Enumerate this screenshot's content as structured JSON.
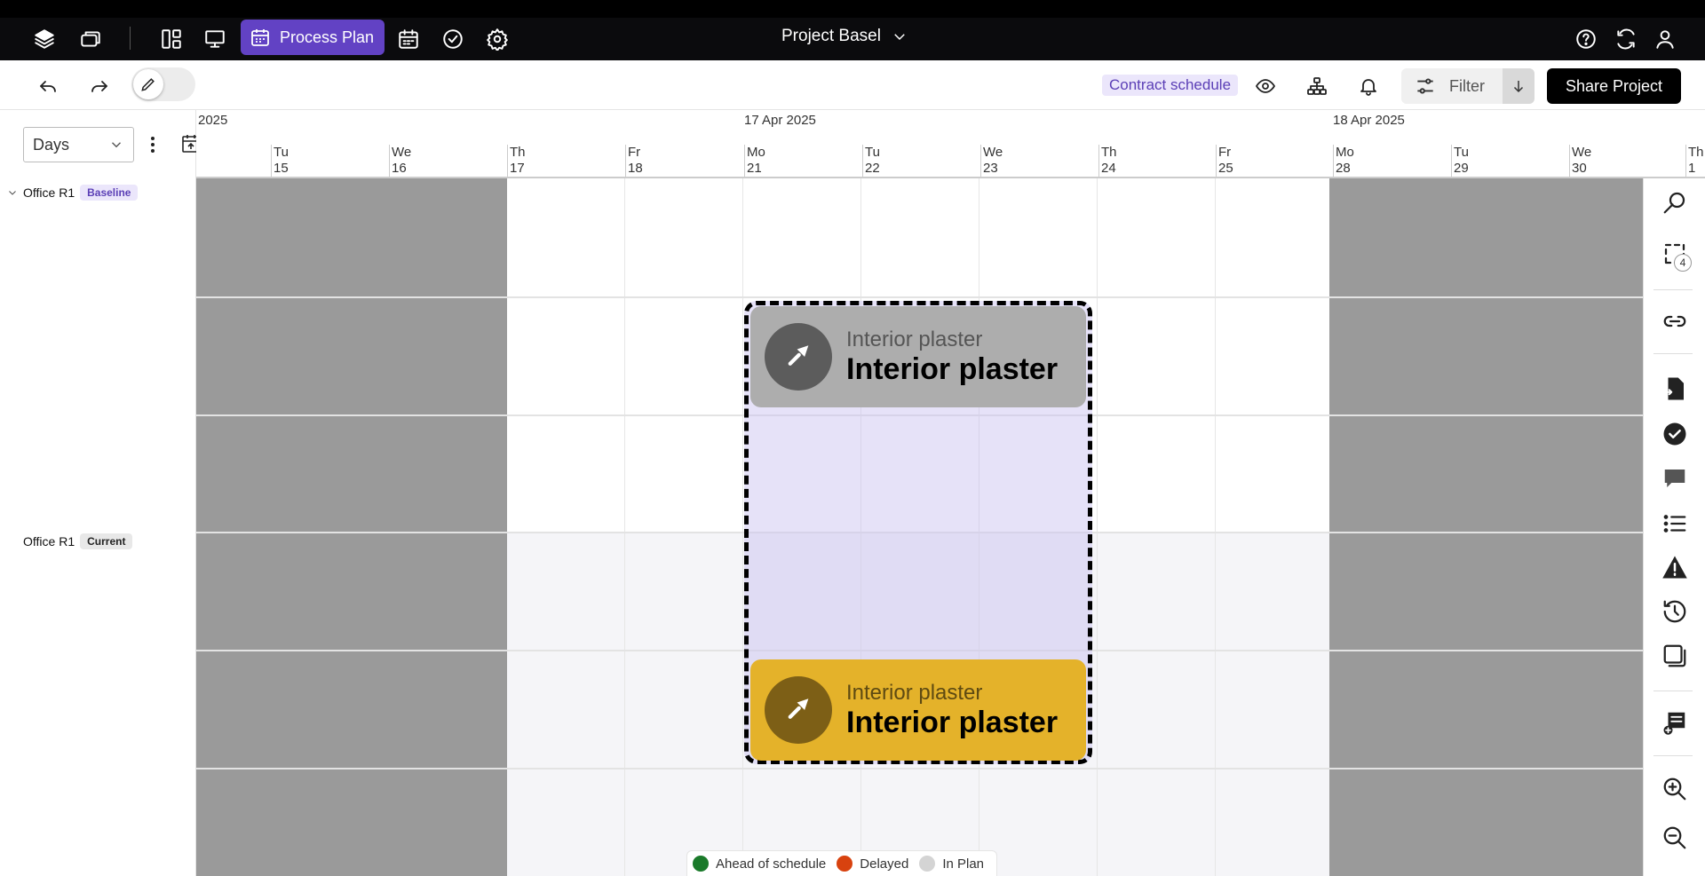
{
  "topbar": {
    "active_tab_label": "Process Plan",
    "project_title": "Project Basel"
  },
  "toolbar": {
    "contract_label": "Contract schedule",
    "filter_label": "Filter",
    "share_label": "Share Project"
  },
  "left_panel": {
    "zoom_select_value": "Days",
    "rows": [
      {
        "label": "Office R1",
        "badge": "Baseline"
      },
      {
        "label": "Office R1",
        "badge": "Current"
      }
    ]
  },
  "timeline": {
    "months": [
      "2025",
      "17 Apr 2025",
      "18 Apr 2025"
    ],
    "days": [
      {
        "dow": "Tu",
        "num": "15"
      },
      {
        "dow": "We",
        "num": "16"
      },
      {
        "dow": "Th",
        "num": "17"
      },
      {
        "dow": "Fr",
        "num": "18"
      },
      {
        "dow": "Mo",
        "num": "21"
      },
      {
        "dow": "Tu",
        "num": "22"
      },
      {
        "dow": "We",
        "num": "23"
      },
      {
        "dow": "Th",
        "num": "24"
      },
      {
        "dow": "Fr",
        "num": "25"
      },
      {
        "dow": "Mo",
        "num": "28"
      },
      {
        "dow": "Tu",
        "num": "29"
      },
      {
        "dow": "We",
        "num": "30"
      },
      {
        "dow": "Th",
        "num": "1"
      }
    ]
  },
  "tasks": {
    "baseline": {
      "subtitle": "Interior plaster",
      "title": "Interior plaster",
      "color": "#adadad"
    },
    "current": {
      "subtitle": "Interior plaster",
      "title": "Interior plaster",
      "color": "#e4b22a"
    }
  },
  "legend": [
    {
      "label": "Ahead of schedule",
      "color": "#1a7a2a"
    },
    {
      "label": "Delayed",
      "color": "#d8420f"
    },
    {
      "label": "In Plan",
      "color": "#d4d4d4"
    }
  ],
  "right_rail": {
    "selection_count": "4"
  },
  "icons": [
    "layers-icon",
    "folders-icon",
    "dashboard-icon",
    "presentation-icon",
    "calendar-icon",
    "check-circle-icon",
    "gear-icon",
    "help-icon",
    "refresh-icon",
    "user-icon",
    "undo-icon",
    "redo-icon",
    "pencil-icon",
    "eye-icon",
    "hierarchy-icon",
    "bell-icon",
    "sliders-icon",
    "arrow-down-icon",
    "search-icon",
    "selection-icon",
    "link-icon",
    "document-import-icon",
    "check-badge-icon",
    "comment-icon",
    "list-icon",
    "warning-icon",
    "history-icon",
    "copy-window-icon",
    "add-table-icon",
    "zoom-in-icon",
    "zoom-out-icon",
    "trowel-icon"
  ],
  "accent_color": "#6242c4"
}
